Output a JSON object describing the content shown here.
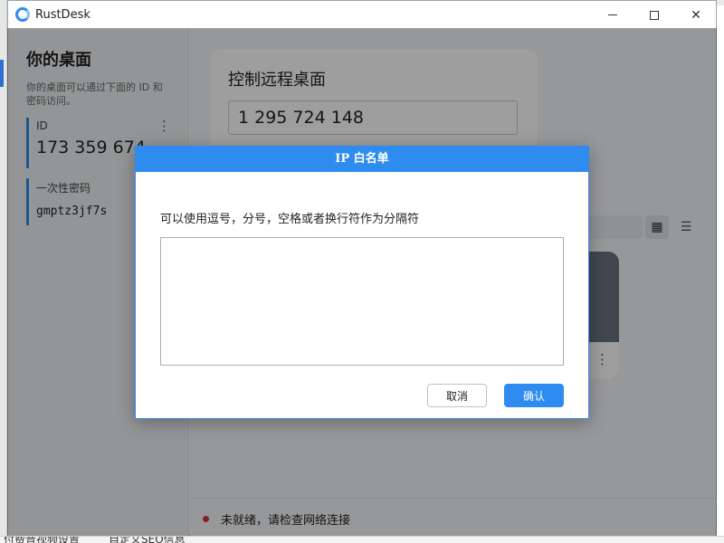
{
  "window": {
    "title": "RustDesk"
  },
  "left": {
    "title": "你的桌面",
    "description": "你的桌面可以通过下面的 ID 和密码访问。",
    "id_label": "ID",
    "id_value": "173 359 674",
    "password_label": "一次性密码",
    "password_value": "gmptz3jf7s"
  },
  "remote": {
    "title": "控制远程桌面",
    "id_input_value": "1 295 724 148"
  },
  "status": {
    "text": "未就绪，请检查网络连接",
    "color": "#d0393e"
  },
  "dialog": {
    "title": "IP 白名单",
    "hint": "可以使用逗号，分号，空格或者换行符作为分隔符",
    "textarea_value": "",
    "cancel_label": "取消",
    "ok_label": "确认"
  },
  "taskbar": {
    "items": [
      "付费音视频设置",
      "自定义SEO信息"
    ]
  },
  "colors": {
    "accent": "#2e8cf0",
    "overlay": "rgba(0,0,0,0.38)"
  }
}
